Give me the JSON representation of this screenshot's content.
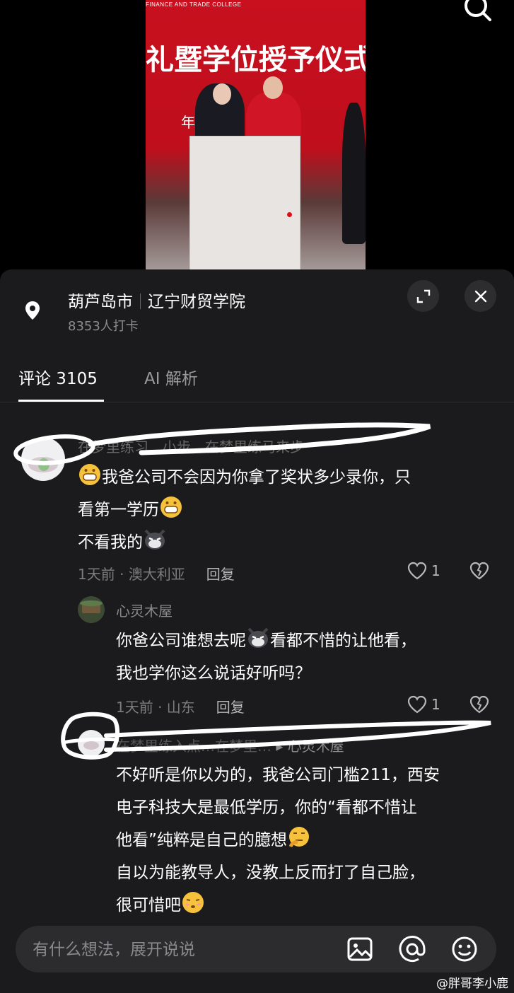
{
  "video": {
    "college_text": "FINANCE AND TRADE COLLEGE",
    "ceremony_text": "礼暨学位授予仪式",
    "date_text": "年六月",
    "search_icon": "search-icon"
  },
  "location": {
    "city": "葫芦岛市",
    "place": "辽宁财贸学院",
    "checkins": "8353人打卡",
    "icon": "location-pin-icon"
  },
  "tabs": [
    {
      "label": "评论 3105",
      "active": true
    },
    {
      "label": "AI 解析",
      "active": false
    }
  ],
  "comments": [
    {
      "username": "在梦里练习…小步…在梦里练马来步",
      "lines": [
        "我爸公司不会因为你拿了奖状多少录你，只",
        "看第一学历",
        "不看我的"
      ],
      "time_location": "1天前 · 澳大利亚",
      "reply_label": "回复",
      "likes": "1"
    },
    {
      "username": "心灵木屋",
      "lines": [
        "你爸公司谁想去呢",
        "看都不惜的让他看，",
        "我也学你这么说话好听吗？"
      ],
      "time_location": "1天前 · 山东",
      "reply_label": "回复",
      "likes": "1"
    },
    {
      "username": "在梦里练入点…在梦里…",
      "reply_to": "▸ 心灵木屋",
      "lines": [
        "不好听是你以为的，我爸公司门槛211，西安",
        "电子科技大是最低学历，你的“看都不惜让",
        "他看”纯粹是自己的臆想",
        "自以为能教导人，没教上反而打了自己脸，",
        "很可惜吧"
      ]
    }
  ],
  "input": {
    "placeholder": "有什么想法，展开说说",
    "icons": [
      "image-icon",
      "mention-icon",
      "emoji-icon"
    ]
  },
  "watermark": "@胖哥李小鹿",
  "colors": {
    "panel": "#1b1b1d",
    "muted": "#7c7c7e",
    "stage_red": "#c8101f"
  }
}
